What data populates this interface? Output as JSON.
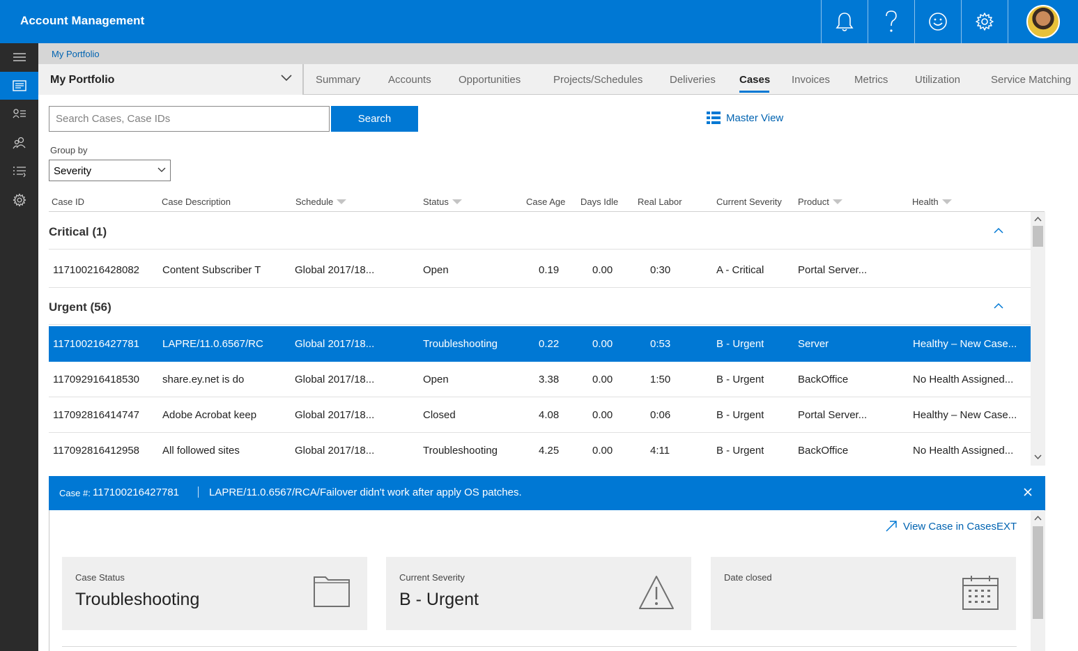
{
  "app": {
    "title": "Account Management"
  },
  "topbar": {
    "icons": [
      "bell-icon",
      "help-icon",
      "smiley-icon",
      "gear-icon",
      "avatar"
    ]
  },
  "leftnav": {
    "items": [
      "hamburger-icon",
      "portfolio-card-icon",
      "contacts-list-icon",
      "people-icon",
      "task-list-icon",
      "settings-gear-icon"
    ]
  },
  "breadcrumb": {
    "text": "My Portfolio"
  },
  "portfolio_selector": {
    "value": "My Portfolio"
  },
  "tabs": [
    {
      "label": "Summary"
    },
    {
      "label": "Accounts"
    },
    {
      "label": "Opportunities"
    },
    {
      "label": "Projects/Schedules"
    },
    {
      "label": "Deliveries"
    },
    {
      "label": "Cases",
      "active": true
    },
    {
      "label": "Invoices"
    },
    {
      "label": "Metrics"
    },
    {
      "label": "Utilization"
    },
    {
      "label": "Service Matching"
    }
  ],
  "search": {
    "placeholder": "Search Cases, Case IDs",
    "value": "",
    "button_label": "Search"
  },
  "master_view": {
    "label": "Master View"
  },
  "group_by": {
    "label": "Group by",
    "value": "Severity"
  },
  "table": {
    "columns": [
      {
        "label": "Case ID"
      },
      {
        "label": "Case Description"
      },
      {
        "label": "Schedule"
      },
      {
        "label": "Status"
      },
      {
        "label": "Case Age"
      },
      {
        "label": "Days Idle"
      },
      {
        "label": "Real Labor"
      },
      {
        "label": "Current Severity"
      },
      {
        "label": "Product"
      },
      {
        "label": "Health"
      }
    ],
    "groups": [
      {
        "title": "Critical (1)",
        "rows": [
          {
            "case_id": "117100216428082",
            "description": "Content Subscriber T",
            "schedule": "Global 2017/18...",
            "status": "Open",
            "case_age": "0.19",
            "days_idle": "0.00",
            "real_labor": "0:30",
            "severity": "A - Critical",
            "product": "Portal Server...",
            "health": ""
          }
        ]
      },
      {
        "title": "Urgent (56)",
        "rows": [
          {
            "case_id": "117100216427781",
            "description": "LAPRE/11.0.6567/RC",
            "schedule": "Global 2017/18...",
            "status": "Troubleshooting",
            "case_age": "0.22",
            "days_idle": "0.00",
            "real_labor": "0:53",
            "severity": "B - Urgent",
            "product": "Server",
            "health": "Healthy – New Case...",
            "selected": true
          },
          {
            "case_id": "117092916418530",
            "description": "share.ey.net is do",
            "schedule": "Global 2017/18...",
            "status": "Open",
            "case_age": "3.38",
            "days_idle": "0.00",
            "real_labor": "1:50",
            "severity": "B - Urgent",
            "product": "BackOffice",
            "health": "No Health Assigned..."
          },
          {
            "case_id": "117092816414747",
            "description": "Adobe Acrobat keep",
            "schedule": "Global 2017/18...",
            "status": "Closed",
            "case_age": "4.08",
            "days_idle": "0.00",
            "real_labor": "0:06",
            "severity": "B - Urgent",
            "product": "Portal Server...",
            "health": "Healthy – New Case..."
          },
          {
            "case_id": "117092816412958",
            "description": "All followed sites",
            "schedule": "Global 2017/18...",
            "status": "Troubleshooting",
            "case_age": "4.25",
            "days_idle": "0.00",
            "real_labor": "4:11",
            "severity": "B - Urgent",
            "product": "BackOffice",
            "health": "No Health Assigned..."
          }
        ]
      }
    ]
  },
  "detail": {
    "case_label": "Case #:",
    "case_number": "117100216427781",
    "case_title": "LAPRE/11.0.6567/RCA/Failover didn't work after apply OS patches.",
    "view_link": "View Case in CasesEXT",
    "cards": [
      {
        "label": "Case Status",
        "value": "Troubleshooting",
        "icon": "folder-icon"
      },
      {
        "label": "Current Severity",
        "value": "B - Urgent",
        "icon": "warning-icon"
      },
      {
        "label": "Date closed",
        "value": "",
        "icon": "calendar-icon"
      }
    ]
  },
  "colors": {
    "accent": "#0078d4",
    "nav_bg": "#2b2b2b",
    "link": "#0063b1"
  }
}
